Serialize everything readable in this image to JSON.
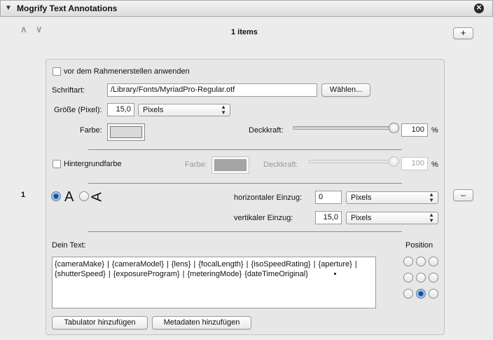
{
  "header": {
    "title": "Mogrify Text Annotations",
    "collapse_icon": "disclosure-triangle-down-icon",
    "close_icon": "close-circle-icon"
  },
  "list": {
    "items_count": "1 items",
    "add_label": "+",
    "remove_label": "–",
    "row_number": "1"
  },
  "options": {
    "before_frame_label": "vor dem Rahmenerstellen anwenden"
  },
  "font": {
    "label": "Schriftart:",
    "path": "/Library/Fonts/MyriadPro-Regular.otf",
    "choose_label": "Wählen..."
  },
  "size": {
    "label": "Größe (Pixel):",
    "value": "15,0",
    "unit": "Pixels"
  },
  "text_color": {
    "label": "Farbe:",
    "swatch": "#d9d9d9",
    "opacity_label": "Deckkraft:",
    "opacity_value": "100",
    "opacity_fraction": 1.0,
    "percent": "%"
  },
  "background": {
    "label": "Hintergrundfarbe",
    "color_label": "Farbe:",
    "swatch": "#a5a5a5",
    "opacity_label": "Deckkraft:",
    "opacity_value": "100",
    "opacity_fraction": 1.0,
    "percent": "%"
  },
  "orientation": {
    "horizontal_glyph": "A",
    "vertical_glyph": "A",
    "selected": "horizontal"
  },
  "indent": {
    "horizontal_label": "horizontaler Einzug:",
    "horizontal_value": "0",
    "horizontal_unit": "Pixels",
    "vertical_label": "vertikaler Einzug:",
    "vertical_value": "15,0",
    "vertical_unit": "Pixels"
  },
  "text": {
    "label": "Dein Text:",
    "content": "{cameraMake} | {cameraModel} | {lens} | {focalLength} | {isoSpeedRating} | {aperture} | {shutterSpeed} | {exposureProgram} | {meteringMode} {dateTimeOriginal}"
  },
  "position": {
    "label": "Position",
    "selected": "bottom-center"
  },
  "buttons": {
    "add_tab": "Tabulator hinzufügen",
    "add_metadata": "Metadaten hinzufügen"
  },
  "colors": {
    "accent": "#1c4f93",
    "panel": "#e7e7e7"
  }
}
